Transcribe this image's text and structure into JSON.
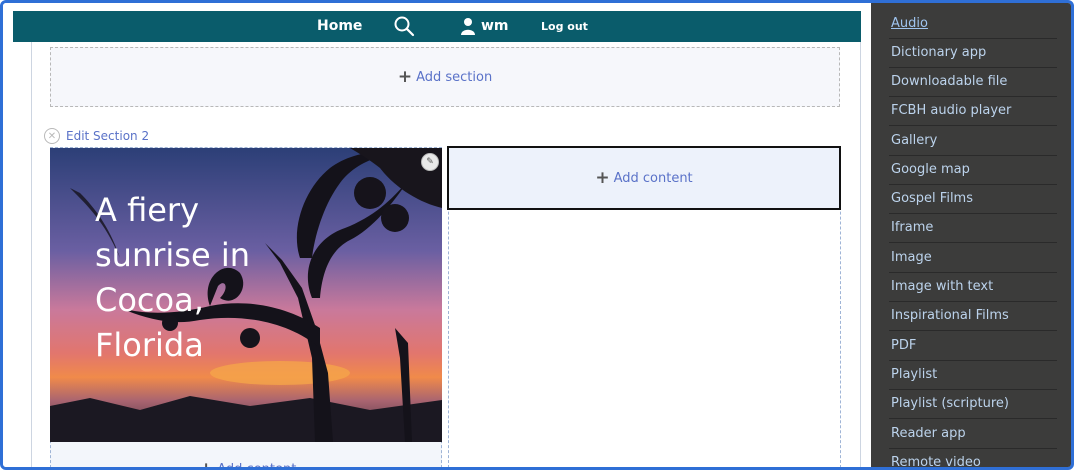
{
  "topbar": {
    "home": "Home",
    "username": "wm",
    "logout": "Log out"
  },
  "builder": {
    "add_section": "Add section",
    "edit_section": "Edit Section 2",
    "add_content": "Add content",
    "add_content_low": "Add content"
  },
  "hero": {
    "text": "A fiery sunrise in Cocoa, Florida"
  },
  "menu": {
    "items": [
      {
        "label": "Audio"
      },
      {
        "label": "Dictionary app"
      },
      {
        "label": "Downloadable file"
      },
      {
        "label": "FCBH audio player"
      },
      {
        "label": "Gallery"
      },
      {
        "label": "Google map"
      },
      {
        "label": "Gospel Films"
      },
      {
        "label": "Iframe"
      },
      {
        "label": "Image"
      },
      {
        "label": "Image with text"
      },
      {
        "label": "Inspirational Films"
      },
      {
        "label": "PDF"
      },
      {
        "label": "Playlist"
      },
      {
        "label": "Playlist (scripture)"
      },
      {
        "label": "Reader app"
      },
      {
        "label": "Remote video"
      }
    ],
    "highlighted": "Google map"
  },
  "colors": {
    "topbar": "#0a5c6b",
    "menu_bg": "#3c3c3b",
    "link": "#5a72c8",
    "highlight": "#e0413a"
  }
}
